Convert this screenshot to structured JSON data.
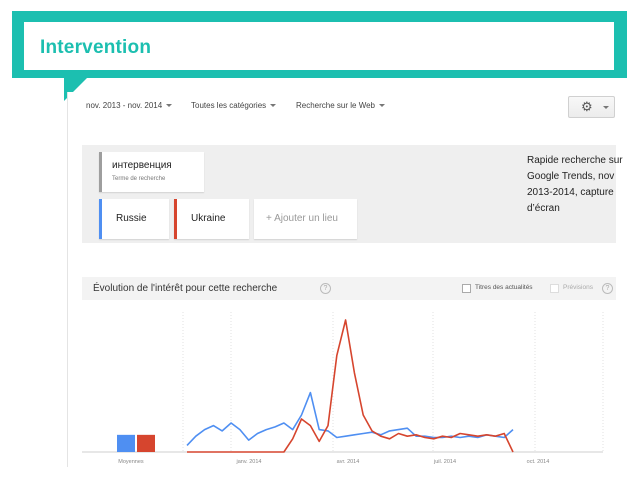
{
  "slide": {
    "title": "Intervention",
    "caption": "Rapide recherche sur Google Trends, nov 2013-2014, capture d’écran"
  },
  "toolbar": {
    "date_range": "nov. 2013 - nov. 2014",
    "categories": "Toutes les catégories",
    "search_type": "Recherche sur le Web"
  },
  "search_term": {
    "term": "интервенция",
    "label": "Terme de recherche"
  },
  "countries": {
    "russia": "Russie",
    "ukraine": "Ukraine",
    "add_place": "+ Ajouter un lieu"
  },
  "section": {
    "title": "Évolution de l'intérêt pour cette recherche",
    "news_headlines": "Titres des actualités",
    "forecasts": "Prévisions"
  },
  "colors": {
    "accent": "#1cbfb0",
    "russia": "#4f8ff2",
    "ukraine": "#d6452e"
  },
  "chart_data": {
    "type": "line",
    "ylim": [
      0,
      100
    ],
    "x_ticks": [
      "Moyennes",
      "janv. 2014",
      "avr. 2014",
      "juil. 2014",
      "oct. 2014"
    ],
    "averages": {
      "Russie": 13,
      "Ukraine": 13
    },
    "series": [
      {
        "name": "Russie",
        "color": "#4f8ff2",
        "values": [
          5,
          12,
          17,
          20,
          16,
          22,
          17,
          9,
          14,
          17,
          19,
          22,
          17,
          28,
          45,
          17,
          16,
          11,
          12,
          13,
          14,
          15,
          13,
          16,
          17,
          18,
          12,
          12,
          11,
          11,
          12,
          11,
          12,
          11,
          13,
          12,
          11,
          17
        ]
      },
      {
        "name": "Ukraine",
        "color": "#d6452e",
        "values": [
          0,
          0,
          0,
          0,
          0,
          0,
          0,
          0,
          0,
          0,
          0,
          0,
          10,
          25,
          20,
          8,
          20,
          73,
          100,
          60,
          28,
          16,
          12,
          10,
          14,
          12,
          13,
          11,
          10,
          12,
          11,
          14,
          13,
          12,
          13,
          12,
          14,
          0
        ]
      }
    ]
  }
}
